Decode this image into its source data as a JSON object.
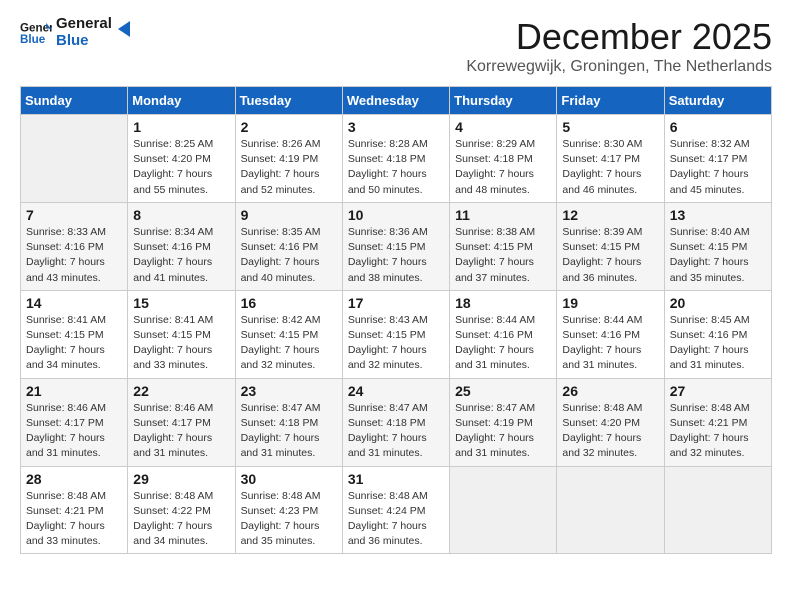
{
  "header": {
    "logo_line1": "General",
    "logo_line2": "Blue",
    "month": "December 2025",
    "location": "Korrewegwijk, Groningen, The Netherlands"
  },
  "days_of_week": [
    "Sunday",
    "Monday",
    "Tuesday",
    "Wednesday",
    "Thursday",
    "Friday",
    "Saturday"
  ],
  "weeks": [
    [
      {
        "day": "",
        "info": ""
      },
      {
        "day": "1",
        "info": "Sunrise: 8:25 AM\nSunset: 4:20 PM\nDaylight: 7 hours\nand 55 minutes."
      },
      {
        "day": "2",
        "info": "Sunrise: 8:26 AM\nSunset: 4:19 PM\nDaylight: 7 hours\nand 52 minutes."
      },
      {
        "day": "3",
        "info": "Sunrise: 8:28 AM\nSunset: 4:18 PM\nDaylight: 7 hours\nand 50 minutes."
      },
      {
        "day": "4",
        "info": "Sunrise: 8:29 AM\nSunset: 4:18 PM\nDaylight: 7 hours\nand 48 minutes."
      },
      {
        "day": "5",
        "info": "Sunrise: 8:30 AM\nSunset: 4:17 PM\nDaylight: 7 hours\nand 46 minutes."
      },
      {
        "day": "6",
        "info": "Sunrise: 8:32 AM\nSunset: 4:17 PM\nDaylight: 7 hours\nand 45 minutes."
      }
    ],
    [
      {
        "day": "7",
        "info": "Sunrise: 8:33 AM\nSunset: 4:16 PM\nDaylight: 7 hours\nand 43 minutes."
      },
      {
        "day": "8",
        "info": "Sunrise: 8:34 AM\nSunset: 4:16 PM\nDaylight: 7 hours\nand 41 minutes."
      },
      {
        "day": "9",
        "info": "Sunrise: 8:35 AM\nSunset: 4:16 PM\nDaylight: 7 hours\nand 40 minutes."
      },
      {
        "day": "10",
        "info": "Sunrise: 8:36 AM\nSunset: 4:15 PM\nDaylight: 7 hours\nand 38 minutes."
      },
      {
        "day": "11",
        "info": "Sunrise: 8:38 AM\nSunset: 4:15 PM\nDaylight: 7 hours\nand 37 minutes."
      },
      {
        "day": "12",
        "info": "Sunrise: 8:39 AM\nSunset: 4:15 PM\nDaylight: 7 hours\nand 36 minutes."
      },
      {
        "day": "13",
        "info": "Sunrise: 8:40 AM\nSunset: 4:15 PM\nDaylight: 7 hours\nand 35 minutes."
      }
    ],
    [
      {
        "day": "14",
        "info": "Sunrise: 8:41 AM\nSunset: 4:15 PM\nDaylight: 7 hours\nand 34 minutes."
      },
      {
        "day": "15",
        "info": "Sunrise: 8:41 AM\nSunset: 4:15 PM\nDaylight: 7 hours\nand 33 minutes."
      },
      {
        "day": "16",
        "info": "Sunrise: 8:42 AM\nSunset: 4:15 PM\nDaylight: 7 hours\nand 32 minutes."
      },
      {
        "day": "17",
        "info": "Sunrise: 8:43 AM\nSunset: 4:15 PM\nDaylight: 7 hours\nand 32 minutes."
      },
      {
        "day": "18",
        "info": "Sunrise: 8:44 AM\nSunset: 4:16 PM\nDaylight: 7 hours\nand 31 minutes."
      },
      {
        "day": "19",
        "info": "Sunrise: 8:44 AM\nSunset: 4:16 PM\nDaylight: 7 hours\nand 31 minutes."
      },
      {
        "day": "20",
        "info": "Sunrise: 8:45 AM\nSunset: 4:16 PM\nDaylight: 7 hours\nand 31 minutes."
      }
    ],
    [
      {
        "day": "21",
        "info": "Sunrise: 8:46 AM\nSunset: 4:17 PM\nDaylight: 7 hours\nand 31 minutes."
      },
      {
        "day": "22",
        "info": "Sunrise: 8:46 AM\nSunset: 4:17 PM\nDaylight: 7 hours\nand 31 minutes."
      },
      {
        "day": "23",
        "info": "Sunrise: 8:47 AM\nSunset: 4:18 PM\nDaylight: 7 hours\nand 31 minutes."
      },
      {
        "day": "24",
        "info": "Sunrise: 8:47 AM\nSunset: 4:18 PM\nDaylight: 7 hours\nand 31 minutes."
      },
      {
        "day": "25",
        "info": "Sunrise: 8:47 AM\nSunset: 4:19 PM\nDaylight: 7 hours\nand 31 minutes."
      },
      {
        "day": "26",
        "info": "Sunrise: 8:48 AM\nSunset: 4:20 PM\nDaylight: 7 hours\nand 32 minutes."
      },
      {
        "day": "27",
        "info": "Sunrise: 8:48 AM\nSunset: 4:21 PM\nDaylight: 7 hours\nand 32 minutes."
      }
    ],
    [
      {
        "day": "28",
        "info": "Sunrise: 8:48 AM\nSunset: 4:21 PM\nDaylight: 7 hours\nand 33 minutes."
      },
      {
        "day": "29",
        "info": "Sunrise: 8:48 AM\nSunset: 4:22 PM\nDaylight: 7 hours\nand 34 minutes."
      },
      {
        "day": "30",
        "info": "Sunrise: 8:48 AM\nSunset: 4:23 PM\nDaylight: 7 hours\nand 35 minutes."
      },
      {
        "day": "31",
        "info": "Sunrise: 8:48 AM\nSunset: 4:24 PM\nDaylight: 7 hours\nand 36 minutes."
      },
      {
        "day": "",
        "info": ""
      },
      {
        "day": "",
        "info": ""
      },
      {
        "day": "",
        "info": ""
      }
    ]
  ]
}
